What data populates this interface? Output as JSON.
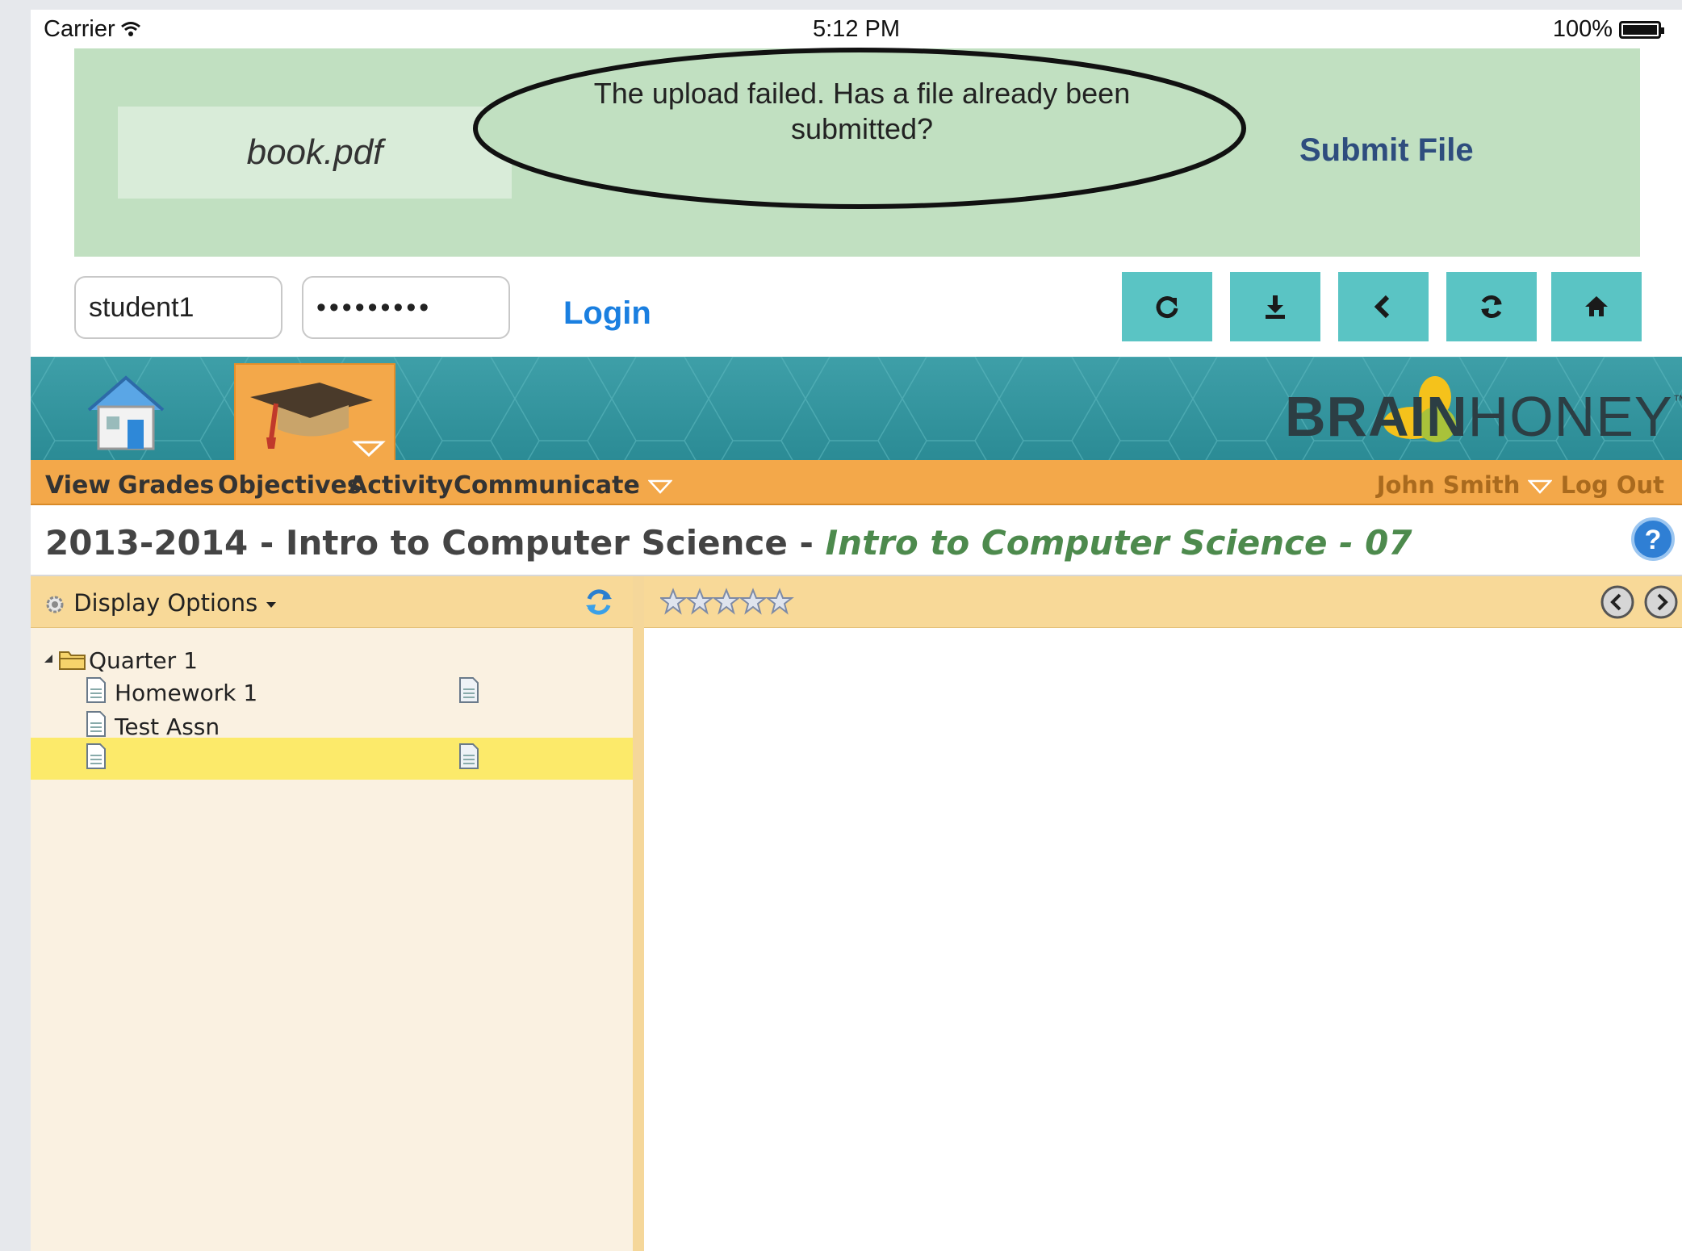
{
  "status_bar": {
    "carrier": "Carrier",
    "time": "5:12 PM",
    "battery": "100%"
  },
  "upload": {
    "file_name": "book.pdf",
    "error_message": "The upload failed. Has a file already been submitted?",
    "submit_label": "Submit File"
  },
  "login": {
    "username": "student1",
    "password": "•••••••••",
    "login_label": "Login"
  },
  "nav_buttons": [
    "share-icon",
    "download-icon",
    "back-icon",
    "refresh-icon",
    "home-icon"
  ],
  "brand": {
    "bold": "BRAIN",
    "light": "HONEY",
    "tm": "™"
  },
  "menu": {
    "items": [
      "View",
      "Grades",
      "Objectives",
      "Activity",
      "Communicate"
    ],
    "user": "John Smith",
    "logout": "Log Out"
  },
  "course": {
    "title": "2013-2014 - Intro to Computer Science - ",
    "section": "Intro to Computer Science - 07"
  },
  "left_pane": {
    "display_options": "Display Options",
    "tree": {
      "folder": "Quarter 1",
      "items": [
        "Homework 1",
        "Test Assn",
        ""
      ]
    }
  },
  "rating": {
    "stars_filled": 0,
    "stars_total": 5
  },
  "colors": {
    "upload_panel": "#c1e0c1",
    "nav_button": "#5ac4c4",
    "menu_bar": "#f3a84a",
    "selected_row": "#fcea6a",
    "login_link": "#1a7fe0"
  }
}
